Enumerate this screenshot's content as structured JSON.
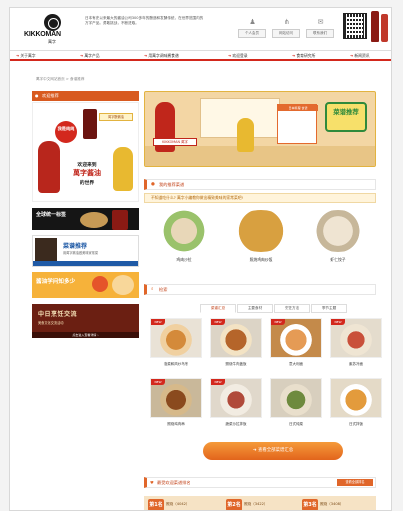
{
  "header": {
    "brand": "KIKKOMAN",
    "brand_sub": "萬字",
    "intro": "日本有史以来最大的酱油公司300多年的酿造和发酵传统，在世界范围内的万字产品。勇敢挑战，不断进取。",
    "links": [
      {
        "label": "个人会员",
        "icon": "person-icon"
      },
      {
        "label": "网站访问",
        "icon": "sitemap-icon"
      },
      {
        "label": "联系我们",
        "icon": "mail-icon"
      }
    ]
  },
  "nav": {
    "items": [
      "关于萬字",
      "萬字产品",
      "用萬字调味酱食谱",
      "欢迎登录",
      "食育研究所",
      "新闻资讯"
    ]
  },
  "breadcrumb": "萬字中文网站首页 > 食谱推荐",
  "left": {
    "title": "欢迎推荐",
    "mascot_bubble": "我是纯纯",
    "mascot_tag": "萬字酿酱油",
    "welcome_line1": "欢迎来到",
    "welcome_line2": "萬字酱油",
    "welcome_line3": "的世界",
    "promo_a": "全球统一标签",
    "promo_b_title": "菜谱推荐",
    "promo_b_sub": "用萬字酱油做美味家常菜",
    "promo_c": "酱油学问知多少",
    "promo_d_title": "中日烹饪交流",
    "promo_d_sub": "美食文化交流活动",
    "promo_d_foot": "点击进入查看详情 ›"
  },
  "hero": {
    "logo": "KIKKOMAN 萬字",
    "card_title": "日本料理 食谱",
    "badge": "菜谱推荐"
  },
  "recommend": {
    "title": "我的推荐菜谱",
    "note": "不知道吃什么? 萬字小编教你做出精致美味的家常菜吧!",
    "cards": [
      "鸡肉沙拉",
      "照烧鸡肉炒饭",
      "虾仁饺子"
    ]
  },
  "search": {
    "title": "检索",
    "tabs": [
      "菜谱汇总",
      "主要食材",
      "烹饪方法",
      "季节主题"
    ],
    "active_tab": 0,
    "grid": [
      {
        "label": "泡菜和风炒乌冬",
        "new": true
      },
      {
        "label": "照烧牛肉盖饭",
        "new": true
      },
      {
        "label": "意大利面",
        "new": true
      },
      {
        "label": "紫苏冷面",
        "new": true
      },
      {
        "label": "照烧鸡肉串",
        "new": true
      },
      {
        "label": "蔬菜沙拉拌饭",
        "new": true
      },
      {
        "label": "日式炖菜",
        "new": false
      },
      {
        "label": "日式拌饭",
        "new": false
      }
    ],
    "new_label": "NEW",
    "cta": "查看全部菜谱汇总"
  },
  "ranking": {
    "title": "最受欢迎菜谱排名",
    "more": "查看全部排名",
    "items": [
      {
        "rank": "第1名",
        "text": "照烧（4042）"
      },
      {
        "rank": "第2名",
        "text": "照烧（3422）"
      },
      {
        "rank": "第3名",
        "text": "照烧（3408）"
      }
    ]
  }
}
